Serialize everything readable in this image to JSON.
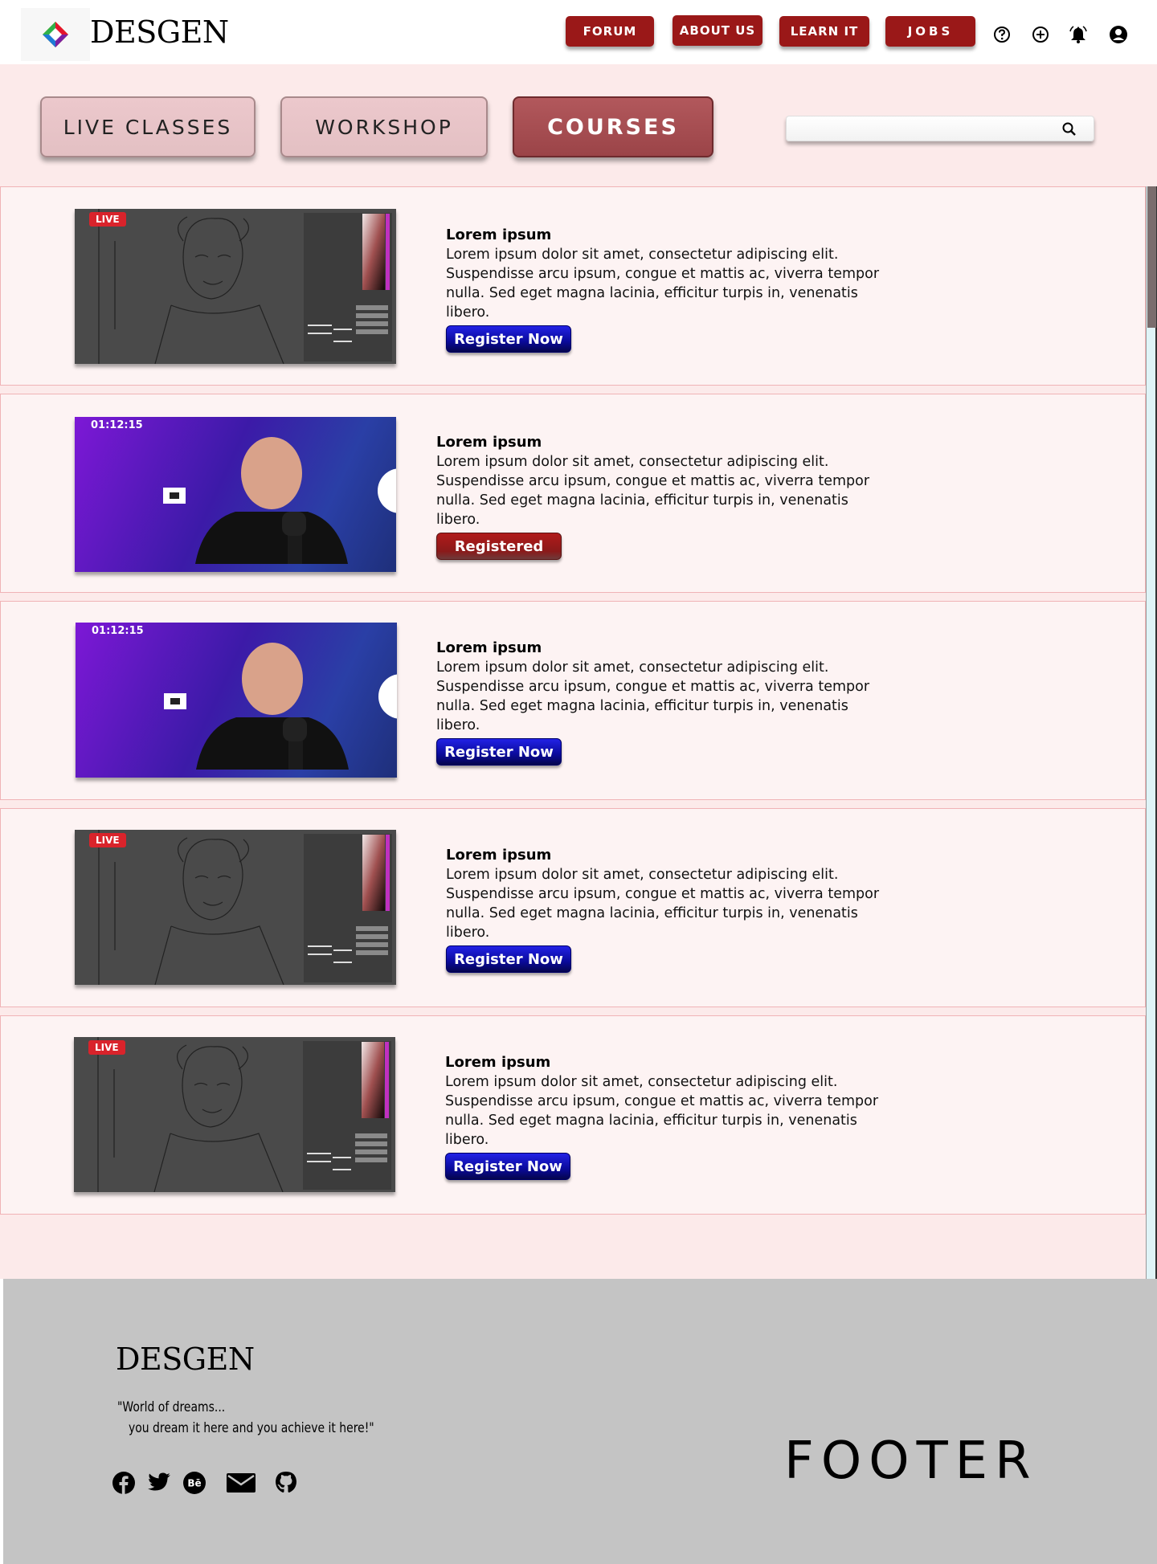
{
  "header": {
    "brand": "DESGEN",
    "nav": [
      {
        "label": "FORUM"
      },
      {
        "label": "ABOUT US"
      },
      {
        "label": "LEARN IT"
      },
      {
        "label": "JOBS"
      }
    ],
    "icons": [
      "help-icon",
      "add-circle-icon",
      "bell-icon",
      "account-icon"
    ]
  },
  "tabs": [
    {
      "label": "LIVE CLASSES",
      "active": false
    },
    {
      "label": "WORKSHOP",
      "active": false
    },
    {
      "label": "COURSES",
      "active": true
    }
  ],
  "search": {
    "value": "",
    "placeholder": ""
  },
  "cards": [
    {
      "thumb": "drawing",
      "badge": "LIVE",
      "title": "Lorem ipsum",
      "desc": "Lorem ipsum dolor sit amet, consectetur adipiscing elit. Suspendisse arcu ipsum, congue et mattis ac, viverra tempor nulla. Sed eget magna lacinia, efficitur turpis in, venenatis libero.",
      "button": "Register Now",
      "button_style": "blue"
    },
    {
      "thumb": "presenter",
      "badge": "01:12:15",
      "title": "Lorem ipsum",
      "desc": "Lorem ipsum dolor sit amet, consectetur adipiscing elit. Suspendisse arcu ipsum, congue et mattis ac, viverra tempor nulla. Sed eget magna lacinia, efficitur turpis in, venenatis libero.",
      "button": "Registered",
      "button_style": "red"
    },
    {
      "thumb": "presenter",
      "badge": "01:12:15",
      "title": "Lorem ipsum",
      "desc": "Lorem ipsum dolor sit amet, consectetur adipiscing elit. Suspendisse arcu ipsum, congue et mattis ac, viverra tempor nulla. Sed eget magna lacinia, efficitur turpis in, venenatis libero.",
      "button": "Register Now",
      "button_style": "blue"
    },
    {
      "thumb": "drawing",
      "badge": "LIVE",
      "title": "Lorem ipsum",
      "desc": "Lorem ipsum dolor sit amet, consectetur adipiscing elit. Suspendisse arcu ipsum, congue et mattis ac, viverra tempor nulla. Sed eget magna lacinia, efficitur turpis in, venenatis libero.",
      "button": "Register Now",
      "button_style": "blue"
    },
    {
      "thumb": "drawing",
      "badge": "LIVE",
      "title": "Lorem ipsum",
      "desc": "Lorem ipsum dolor sit amet, consectetur adipiscing elit. Suspendisse arcu ipsum, congue et mattis ac, viverra tempor nulla. Sed eget magna lacinia, efficitur turpis in, venenatis libero.",
      "button": "Register Now",
      "button_style": "blue"
    }
  ],
  "footer": {
    "brand": "DESGEN",
    "quote_line1": "\"World of dreams...",
    "quote_line2": "you dream it here and you achieve it here!\"",
    "social": [
      "facebook-icon",
      "twitter-icon",
      "behance-icon",
      "mail-icon",
      "github-icon"
    ],
    "big_label": "FOOTER"
  },
  "colors": {
    "nav_button": "#9a1818",
    "strip_bg": "#fceaea",
    "card_bg": "#fdf3f3",
    "active_tab": "#a24a4e",
    "register_blue": "#0a0a9a",
    "registered_red": "#8a1a1a",
    "footer_bg": "#c4c4c4"
  }
}
